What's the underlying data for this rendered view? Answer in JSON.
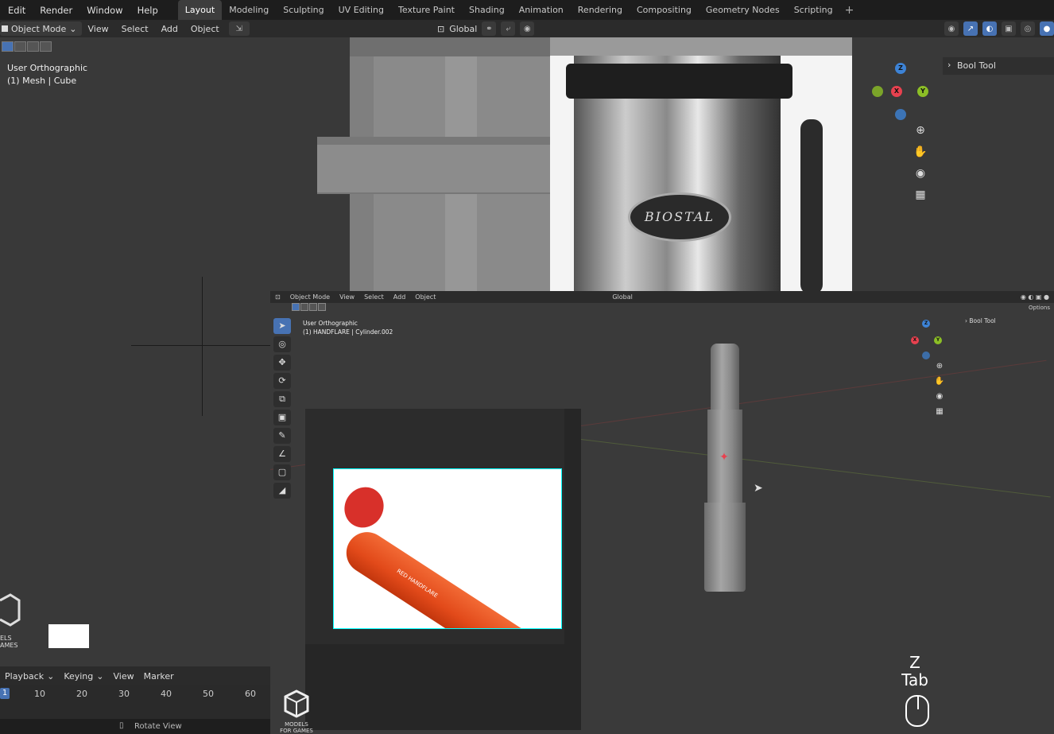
{
  "topbar": {
    "menus": [
      "Edit",
      "Render",
      "Window",
      "Help"
    ],
    "workspaces": [
      "Layout",
      "Modeling",
      "Sculpting",
      "UV Editing",
      "Texture Paint",
      "Shading",
      "Animation",
      "Rendering",
      "Compositing",
      "Geometry Nodes",
      "Scripting"
    ],
    "active_workspace": "Layout",
    "add_tab": "+"
  },
  "upper_viewport": {
    "mode": "Object Mode",
    "menus": [
      "View",
      "Select",
      "Add",
      "Object"
    ],
    "transform_orientation": "Global",
    "info_line1": "User Orthographic",
    "info_line2": "(1) Mesh | Cube",
    "n_panel_tab": "Bool Tool",
    "logo_text": "BIOSTAL",
    "gizmo": {
      "z": "Z",
      "x": "X",
      "y": "Y"
    }
  },
  "lower_viewport": {
    "mode": "Object Mode",
    "menus": [
      "View",
      "Select",
      "Add",
      "Object"
    ],
    "transform_orientation": "Global",
    "info_line1": "User Orthographic",
    "info_line2": "(1) HANDFLARE | Cylinder.002",
    "n_panel_tab": "Bool Tool",
    "options_label": "Options",
    "flare_label": "RED HANDFLARE",
    "logo_text_line1": "MODELS",
    "logo_text_line2": "FOR GAMES"
  },
  "left_logo": {
    "line1": "ELS",
    "line2": "AMES"
  },
  "timeline": {
    "menus": [
      "Playback",
      "Keying",
      "View",
      "Marker"
    ],
    "current_frame": "1",
    "ticks": [
      "10",
      "20",
      "30",
      "40",
      "50",
      "60"
    ]
  },
  "statusbar": {
    "hint": "Rotate View"
  },
  "key_overlay": {
    "line1": "Z",
    "line2": "Tab"
  },
  "colors": {
    "accent": "#4772b3",
    "axis_x": "#e8414f",
    "axis_y": "#8cbf26",
    "axis_z": "#3d83d6"
  }
}
